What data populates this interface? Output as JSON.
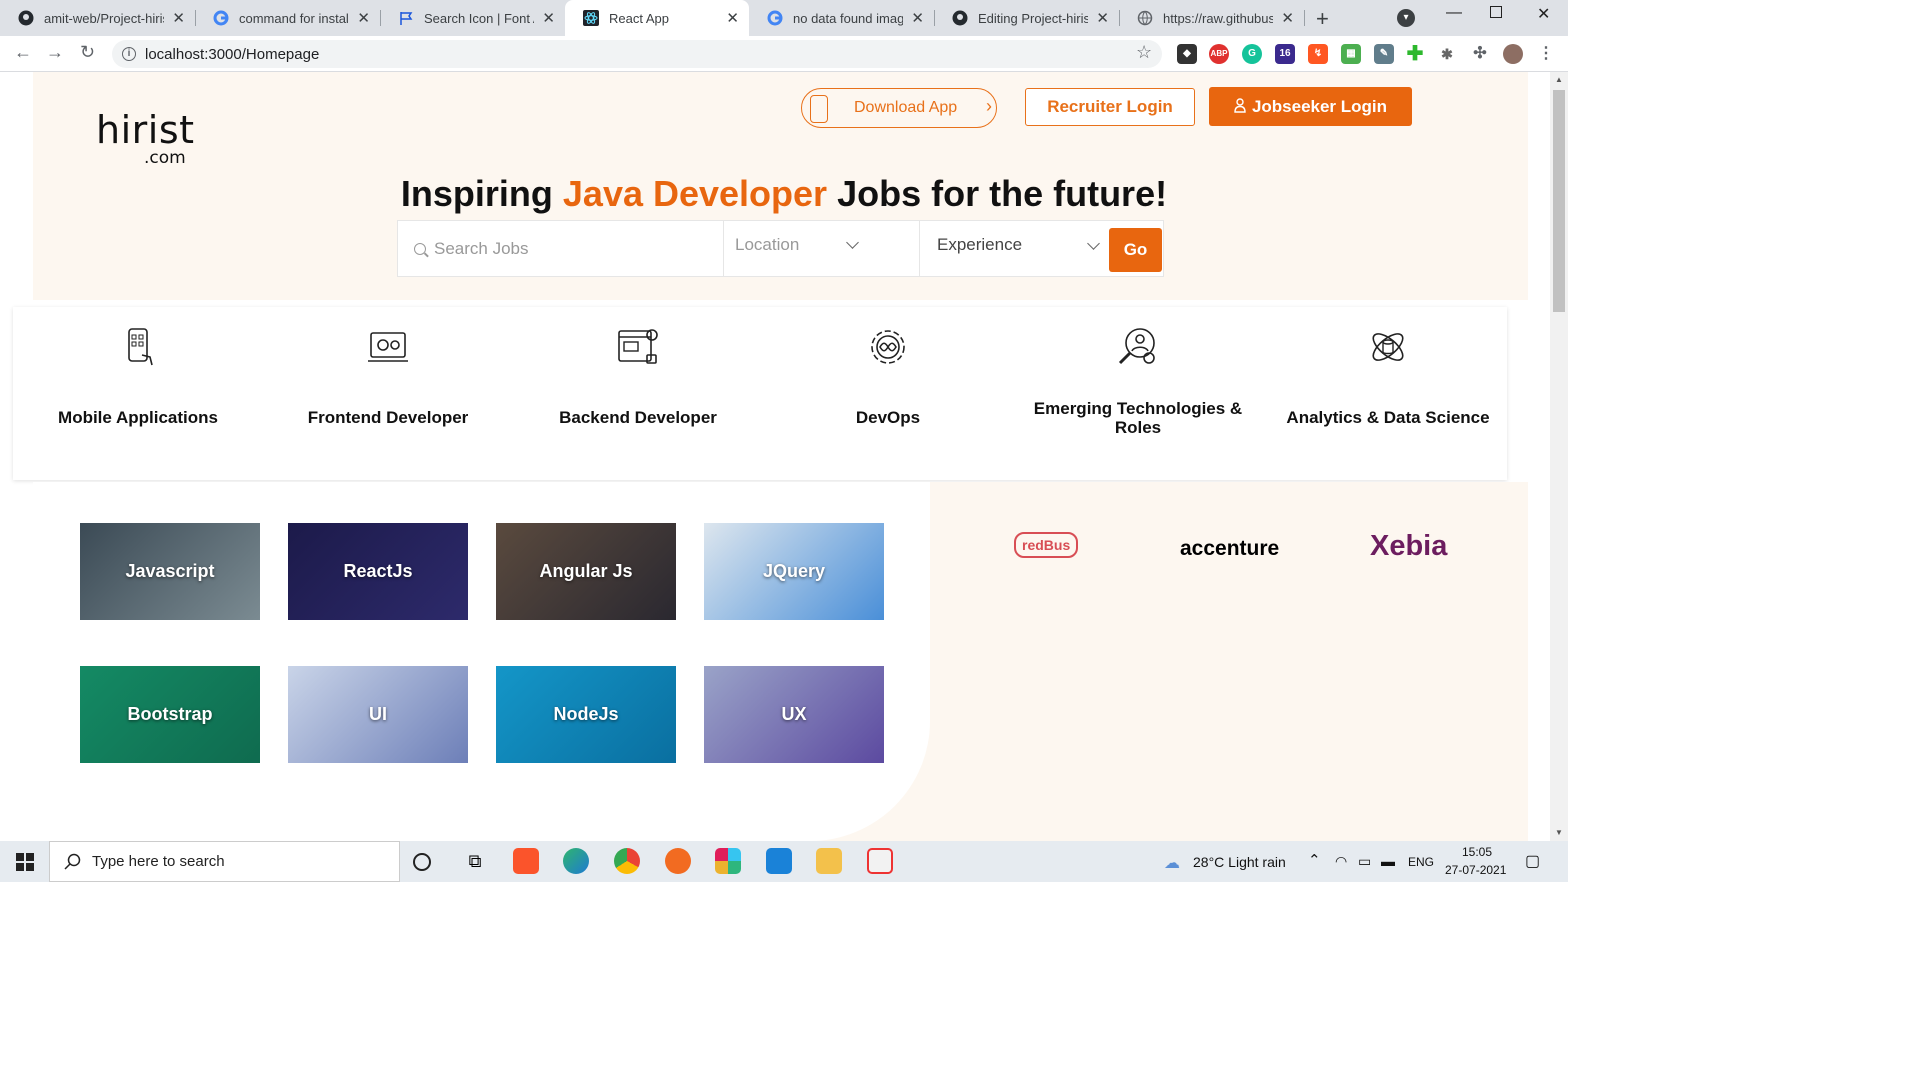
{
  "browser": {
    "tabs": [
      {
        "title": "amit-web/Project-hiris",
        "icon": "github-icon"
      },
      {
        "title": "command for install n",
        "icon": "google-icon"
      },
      {
        "title": "Search Icon | Font Aw",
        "icon": "flag-icon"
      },
      {
        "title": "React App",
        "icon": "react-icon"
      },
      {
        "title": "no data found image",
        "icon": "google-icon"
      },
      {
        "title": "Editing Project-hirist-c",
        "icon": "github-icon"
      },
      {
        "title": "https://raw.githubuser",
        "icon": "globe-icon"
      }
    ],
    "active_tab": 3,
    "url": "localhost:3000/Homepage"
  },
  "header": {
    "logo_main": "hirist",
    "logo_sub": ".com",
    "download_label": "Download App",
    "recruiter_label": "Recruiter Login",
    "jobseeker_label": "Jobseeker Login"
  },
  "hero": {
    "headline_pre": "Inspiring ",
    "headline_accent": "Java Developer",
    "headline_post": " Jobs for the future!",
    "search_placeholder": "Search Jobs",
    "location_placeholder": "Location",
    "experience_placeholder": "Experience",
    "go_label": "Go"
  },
  "categories": [
    {
      "label": "Mobile Applications",
      "icon": "mobile-app-icon"
    },
    {
      "label": "Frontend Developer",
      "icon": "frontend-gear-icon"
    },
    {
      "label": "Backend Developer",
      "icon": "backend-screen-icon"
    },
    {
      "label": "DevOps",
      "icon": "devops-gear-icon"
    },
    {
      "label": "Emerging Technologies & Roles",
      "icon": "search-person-icon"
    },
    {
      "label": "Analytics & Data Science",
      "icon": "data-science-icon"
    }
  ],
  "skills": [
    {
      "label": "Javascript"
    },
    {
      "label": "ReactJs"
    },
    {
      "label": "Angular Js"
    },
    {
      "label": "JQuery"
    },
    {
      "label": "Bootstrap"
    },
    {
      "label": "UI"
    },
    {
      "label": "NodeJs"
    },
    {
      "label": "UX"
    }
  ],
  "companies": [
    {
      "name": "redBus",
      "color": "#d84e55"
    },
    {
      "name": "accenture",
      "color": "#000000"
    },
    {
      "name": "Xebia",
      "color": "#6c1d5f"
    }
  ],
  "taskbar": {
    "search_placeholder": "Type here to search",
    "weather": "28°C  Light rain",
    "lang": "ENG",
    "time": "15:05",
    "date": "27-07-2021"
  },
  "colors": {
    "accent": "#e8660f",
    "hero_bg": "#fdf7f0"
  }
}
